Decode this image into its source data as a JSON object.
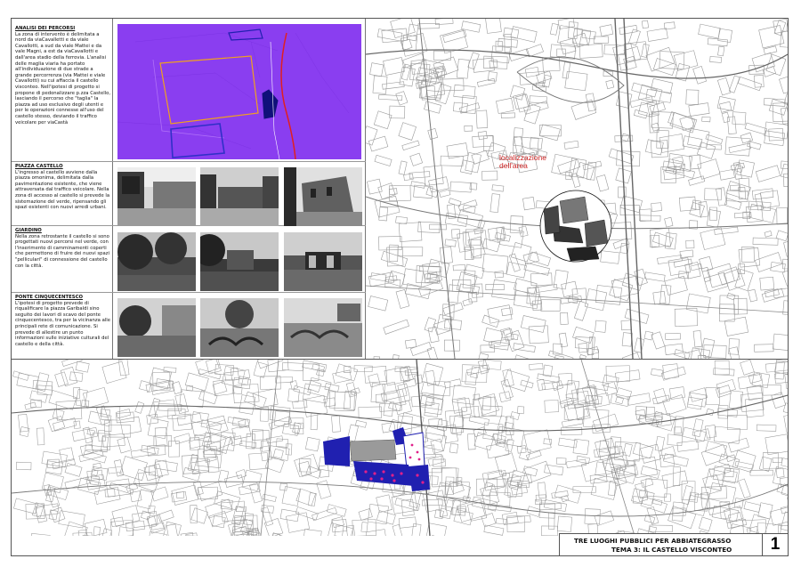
{
  "sections": [
    {
      "title": "ANALISI DEI PERCORSI",
      "text": "La zona di intervento è delimitata a nord da viaCavalletti e da viale Cavallotti, a sud da viale Mattei e da vale Magni, a est da viaCavallotti e dall'area stadio della ferrovia. L'analisi delle maglia viaria ha portato all'individuazione di due strade a grande percorrenza (via Mattei e viale Cavallotti) su cui affaccia il castello visconteo. Nell'ipotesi di progetto si propone di pedonalizzare p.zza Castello, lasciando il percorso che \"taglia\" la piazza ad uso esclusivo degli utenti e per le operazioni connesse all'uso del castello stesso, deviando il traffico veicolare per viaCastà"
    },
    {
      "title": "PIAZZA CASTELLO",
      "text": "L'ingresso al castello avviene dalla piazza omonima, delimitata dalla pavimentazione esistente, che viene attraversata dal traffico veicolare. Nella zona di accesso al castello si prevede la sistemazione del verde, ripensando gli spazi esistenti con nuovi arredi urbani."
    },
    {
      "title": "GIARDINO",
      "text": "Nella zona retrostante il castello si sono progettati nuovi percorsi nel verde, con l'inserimento di camminamenti coperti che permettono di fruire dei nuovi spazi \"pelliculari\" di connessione del castello con la città."
    },
    {
      "title": "PONTE CINQUECENTESCO",
      "text": "L'ipotesi di progetto prevede di riqualificare la piazza Garibaldi sino seguito dei lavori di scavo del ponte cinquecentesco, tra per la vicinanza alle principali rete di comunicazione. Si prevede di allestire un punto informazioni sulle iniziative culturali del castello e della città."
    }
  ],
  "map_labels": {
    "localizzazione": "localizzazione dell'area"
  },
  "title_block": {
    "line1": "TRE LUOGHI PUBBLICI PER ABBIATEGRASSO",
    "line2": "TEMA 3: IL CASTELLO VISCONTEO",
    "sheet_number": "1"
  },
  "colors": {
    "diagram_bg": "#8a3ef0",
    "route_orange": "#f0a020",
    "route_red": "#e02020",
    "route_blue": "#3030c8",
    "label_red": "#cc2222",
    "pink": "#e0208a",
    "navy": "#10107a"
  }
}
